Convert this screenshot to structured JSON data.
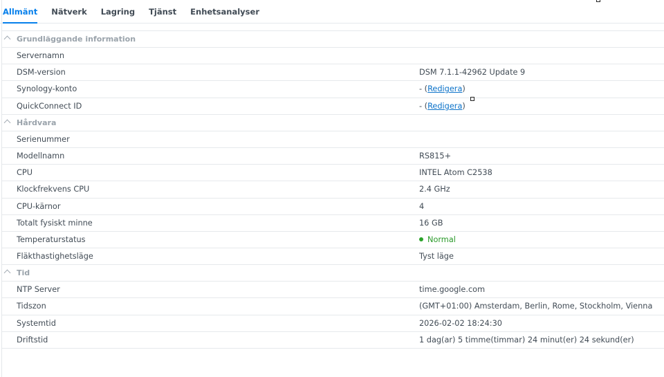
{
  "tabs": [
    {
      "label": "Allmänt",
      "active": true
    },
    {
      "label": "Nätverk",
      "active": false
    },
    {
      "label": "Lagring",
      "active": false
    },
    {
      "label": "Tjänst",
      "active": false
    },
    {
      "label": "Enhetsanalyser",
      "active": false
    }
  ],
  "groups": {
    "basic": {
      "title": "Grundläggande information",
      "rows": {
        "server_name": {
          "label": "Servernamn",
          "value": ""
        },
        "dsm_version": {
          "label": "DSM-version",
          "value": "DSM 7.1.1-42962 Update 9"
        },
        "synology_account": {
          "label": "Synology-konto",
          "value_prefix": "- (",
          "link": "Redigera",
          "value_suffix": ")"
        },
        "quickconnect_id": {
          "label": "QuickConnect ID",
          "value_prefix": "- (",
          "link": "Redigera",
          "value_suffix": ")"
        }
      }
    },
    "hardware": {
      "title": "Hårdvara",
      "rows": {
        "serial": {
          "label": "Serienummer",
          "value": ""
        },
        "model": {
          "label": "Modellnamn",
          "value": "RS815+"
        },
        "cpu": {
          "label": "CPU",
          "value": "INTEL Atom C2538"
        },
        "cpu_clock": {
          "label": "Klockfrekvens CPU",
          "value": "2.4 GHz"
        },
        "cpu_cores": {
          "label": "CPU-kärnor",
          "value": "4"
        },
        "memory": {
          "label": "Totalt fysiskt minne",
          "value": "16 GB"
        },
        "temperature": {
          "label": "Temperaturstatus",
          "value": "Normal",
          "status_color": "#2aa32a"
        },
        "fan": {
          "label": "Fläkthastighetsläge",
          "value": "Tyst läge"
        }
      }
    },
    "time": {
      "title": "Tid",
      "rows": {
        "ntp": {
          "label": "NTP Server",
          "value": "time.google.com"
        },
        "timezone": {
          "label": "Tidszon",
          "value": "(GMT+01:00) Amsterdam, Berlin, Rome, Stockholm, Vienna"
        },
        "system_time": {
          "label": "Systemtid",
          "value": "2026-02-02 18:24:30"
        },
        "uptime": {
          "label": "Driftstid",
          "value": "1 dag(ar) 5 timme(timmar) 24 minut(er) 24 sekund(er)"
        }
      }
    }
  },
  "colors": {
    "accent": "#057feb",
    "link": "#0b72c9",
    "status_ok": "#2aa32a"
  }
}
